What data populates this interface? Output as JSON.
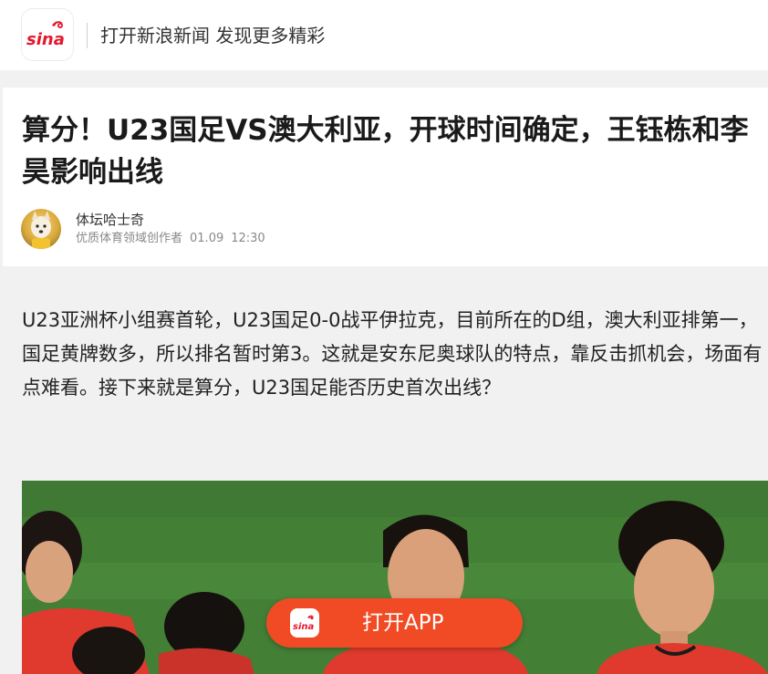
{
  "topbar": {
    "logo_text": "sina",
    "slogan": "打开新浪新闻 发现更多精彩"
  },
  "article": {
    "title": "算分！U23国足VS澳大利亚，开球时间确定，王钰栋和李昊影响出线",
    "author": {
      "name": "体坛哈士奇",
      "role": "优质体育领域创作者",
      "date": "01.09",
      "time": "12:30"
    },
    "paragraph": "U23亚洲杯小组赛首轮，U23国足0-0战平伊拉克，目前所在的D组，澳大利亚排第一，国足黄牌数多，所以排名暂时第3。这就是安东尼奥球队的特点，靠反击抓机会，场面有点难看。接下来就是算分，U23国足能否历史首次出线？"
  },
  "cta": {
    "label": "打开APP"
  },
  "colors": {
    "brand_red": "#e6162d",
    "cta_orange": "#f04b24",
    "jersey_red": "#e03a2e"
  }
}
